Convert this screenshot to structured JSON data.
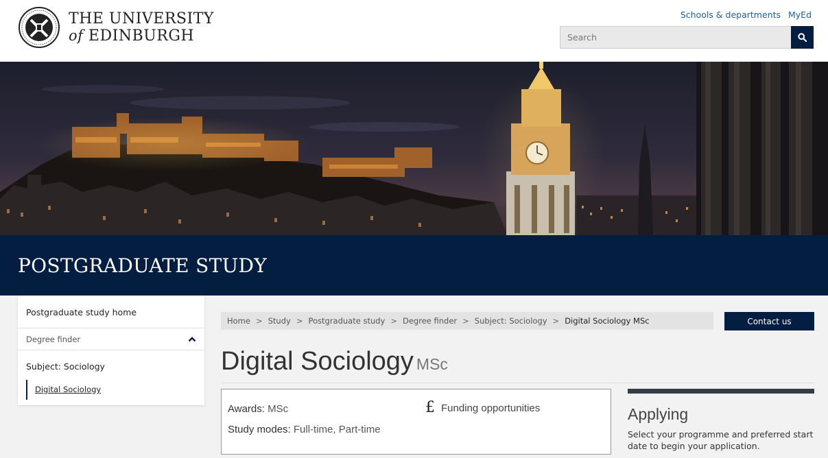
{
  "header": {
    "logo_line1": "THE UNIVERSITY",
    "logo_line2_prefix": "of",
    "logo_line2": "EDINBURGH",
    "links": [
      {
        "label": "Schools & departments"
      },
      {
        "label": "MyEd"
      }
    ],
    "search": {
      "placeholder": "Search"
    }
  },
  "banner": {
    "title": "POSTGRADUATE STUDY"
  },
  "sidebar": {
    "home": "Postgraduate study home",
    "finder": "Degree finder",
    "subject": "Subject: Sociology",
    "current": "Digital Sociology"
  },
  "breadcrumb": [
    "Home",
    "Study",
    "Postgraduate study",
    "Degree finder",
    "Subject: Sociology",
    "Digital Sociology MSc"
  ],
  "contact_label": "Contact us",
  "programme": {
    "title": "Digital Sociology",
    "award": "MSc",
    "awards_label": "Awards:",
    "awards_value": "MSc",
    "modes_label": "Study modes:",
    "modes_value": "Full-time, Part-time",
    "funding_label": "Funding opportunities"
  },
  "applying": {
    "heading": "Applying",
    "text": "Select your programme and preferred start date to begin your application."
  },
  "colors": {
    "navy": "#041e42",
    "link": "#1f5c99"
  },
  "icons": [
    "university-crest-icon",
    "search-icon",
    "chevron-up-icon",
    "pound-icon"
  ]
}
